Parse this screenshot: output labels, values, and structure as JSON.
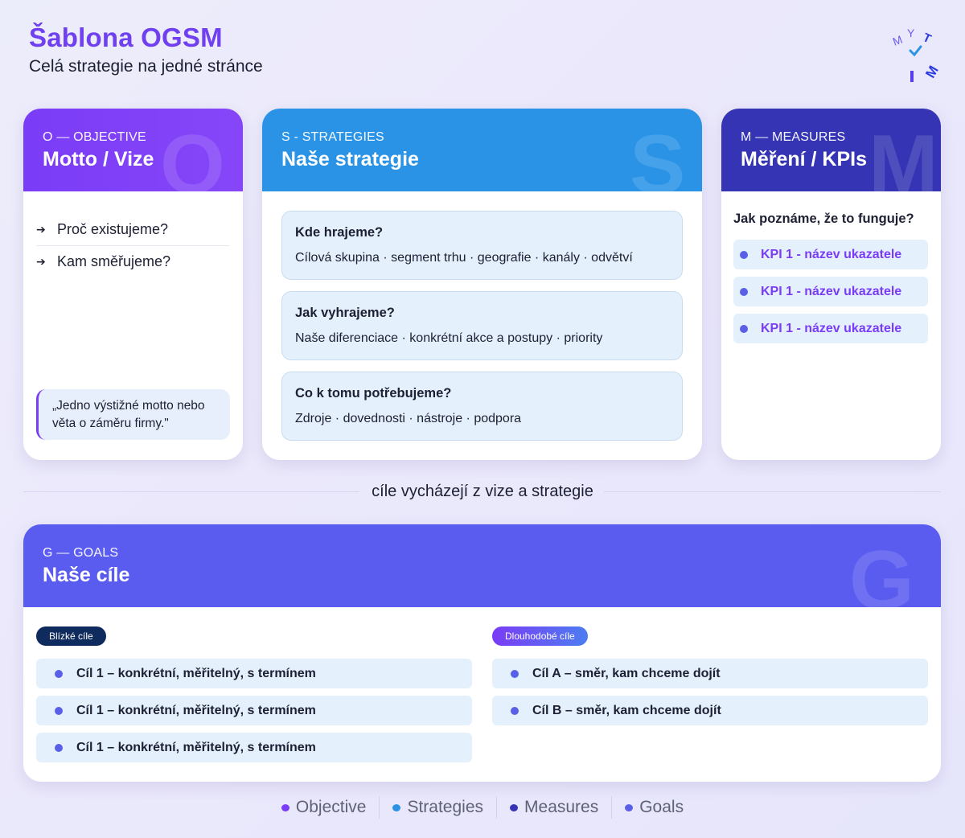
{
  "header": {
    "title": "Šablona OGSM",
    "subtitle": "Celá strategie na jedné stránce"
  },
  "logo": {
    "letters": [
      "M",
      "Y",
      "T",
      "I",
      "M"
    ],
    "icon": "mytim-logo"
  },
  "objective": {
    "kicker": "O — OBJECTIVE",
    "heading": "Motto / Vize",
    "letter": "O",
    "items": [
      "Proč existujeme?",
      "Kam směřujeme?"
    ],
    "quote": "„Jedno výstižné motto nebo věta o záměru firmy.\"",
    "color": "#7a3cf6"
  },
  "strategies": {
    "kicker": "S - STRATEGIES",
    "heading": "Naše strategie",
    "letter": "S",
    "color": "#2a93e6",
    "boxes": [
      {
        "title": "Kde hrajeme?",
        "text": "Cílová skupina · segment trhu · geografie · kanály · odvětví"
      },
      {
        "title": "Jak vyhrajeme?",
        "text": "Naše diferenciace · konkrétní akce a postupy · priority"
      },
      {
        "title": "Co k tomu potřebujeme?",
        "text": "Zdroje · dovednosti · nástroje · podpora"
      }
    ]
  },
  "measures": {
    "kicker": "M — MEASURES",
    "heading": "Měření / KPIs",
    "letter": "M",
    "color": "#3434b4",
    "question": "Jak poznáme, že to funguje?",
    "kpis": [
      "KPI 1 - název ukazatele",
      "KPI 1 - název ukazatele",
      "KPI 1 - název ukazatele"
    ]
  },
  "divider": {
    "text": "cíle vycházejí z vize a strategie"
  },
  "goals": {
    "kicker": "G — GOALS",
    "heading": "Naše cíle",
    "letter": "G",
    "color": "#5a5cf0",
    "near": {
      "label": "Blízké cíle",
      "color": "#0f2a5c",
      "items": [
        "Cíl 1 – konkrétní, měřitelný, s termínem",
        "Cíl 1 – konkrétní, měřitelný, s termínem",
        "Cíl 1 – konkrétní, měřitelný, s termínem"
      ]
    },
    "long": {
      "label": "Dlouhodobé cíle",
      "color": "#6a4cf0",
      "items": [
        "Cíl A – směr, kam chceme dojít",
        "Cíl B – směr, kam chceme dojít"
      ]
    }
  },
  "legend": [
    {
      "label": "Objective",
      "color": "#7a3cf6"
    },
    {
      "label": "Strategies",
      "color": "#2a93e6"
    },
    {
      "label": "Measures",
      "color": "#3434b4"
    },
    {
      "label": "Goals",
      "color": "#5a5fe8"
    }
  ]
}
